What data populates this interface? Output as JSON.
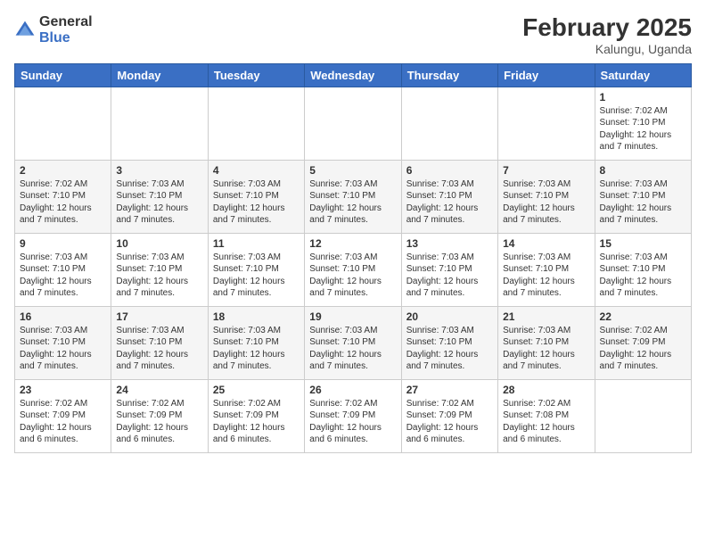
{
  "logo": {
    "general": "General",
    "blue": "Blue"
  },
  "title": "February 2025",
  "location": "Kalungu, Uganda",
  "days_header": [
    "Sunday",
    "Monday",
    "Tuesday",
    "Wednesday",
    "Thursday",
    "Friday",
    "Saturday"
  ],
  "weeks": [
    [
      {
        "day": "",
        "info": ""
      },
      {
        "day": "",
        "info": ""
      },
      {
        "day": "",
        "info": ""
      },
      {
        "day": "",
        "info": ""
      },
      {
        "day": "",
        "info": ""
      },
      {
        "day": "",
        "info": ""
      },
      {
        "day": "1",
        "info": "Sunrise: 7:02 AM\nSunset: 7:10 PM\nDaylight: 12 hours\nand 7 minutes."
      }
    ],
    [
      {
        "day": "2",
        "info": "Sunrise: 7:02 AM\nSunset: 7:10 PM\nDaylight: 12 hours\nand 7 minutes."
      },
      {
        "day": "3",
        "info": "Sunrise: 7:03 AM\nSunset: 7:10 PM\nDaylight: 12 hours\nand 7 minutes."
      },
      {
        "day": "4",
        "info": "Sunrise: 7:03 AM\nSunset: 7:10 PM\nDaylight: 12 hours\nand 7 minutes."
      },
      {
        "day": "5",
        "info": "Sunrise: 7:03 AM\nSunset: 7:10 PM\nDaylight: 12 hours\nand 7 minutes."
      },
      {
        "day": "6",
        "info": "Sunrise: 7:03 AM\nSunset: 7:10 PM\nDaylight: 12 hours\nand 7 minutes."
      },
      {
        "day": "7",
        "info": "Sunrise: 7:03 AM\nSunset: 7:10 PM\nDaylight: 12 hours\nand 7 minutes."
      },
      {
        "day": "8",
        "info": "Sunrise: 7:03 AM\nSunset: 7:10 PM\nDaylight: 12 hours\nand 7 minutes."
      }
    ],
    [
      {
        "day": "9",
        "info": "Sunrise: 7:03 AM\nSunset: 7:10 PM\nDaylight: 12 hours\nand 7 minutes."
      },
      {
        "day": "10",
        "info": "Sunrise: 7:03 AM\nSunset: 7:10 PM\nDaylight: 12 hours\nand 7 minutes."
      },
      {
        "day": "11",
        "info": "Sunrise: 7:03 AM\nSunset: 7:10 PM\nDaylight: 12 hours\nand 7 minutes."
      },
      {
        "day": "12",
        "info": "Sunrise: 7:03 AM\nSunset: 7:10 PM\nDaylight: 12 hours\nand 7 minutes."
      },
      {
        "day": "13",
        "info": "Sunrise: 7:03 AM\nSunset: 7:10 PM\nDaylight: 12 hours\nand 7 minutes."
      },
      {
        "day": "14",
        "info": "Sunrise: 7:03 AM\nSunset: 7:10 PM\nDaylight: 12 hours\nand 7 minutes."
      },
      {
        "day": "15",
        "info": "Sunrise: 7:03 AM\nSunset: 7:10 PM\nDaylight: 12 hours\nand 7 minutes."
      }
    ],
    [
      {
        "day": "16",
        "info": "Sunrise: 7:03 AM\nSunset: 7:10 PM\nDaylight: 12 hours\nand 7 minutes."
      },
      {
        "day": "17",
        "info": "Sunrise: 7:03 AM\nSunset: 7:10 PM\nDaylight: 12 hours\nand 7 minutes."
      },
      {
        "day": "18",
        "info": "Sunrise: 7:03 AM\nSunset: 7:10 PM\nDaylight: 12 hours\nand 7 minutes."
      },
      {
        "day": "19",
        "info": "Sunrise: 7:03 AM\nSunset: 7:10 PM\nDaylight: 12 hours\nand 7 minutes."
      },
      {
        "day": "20",
        "info": "Sunrise: 7:03 AM\nSunset: 7:10 PM\nDaylight: 12 hours\nand 7 minutes."
      },
      {
        "day": "21",
        "info": "Sunrise: 7:03 AM\nSunset: 7:10 PM\nDaylight: 12 hours\nand 7 minutes."
      },
      {
        "day": "22",
        "info": "Sunrise: 7:02 AM\nSunset: 7:09 PM\nDaylight: 12 hours\nand 7 minutes."
      }
    ],
    [
      {
        "day": "23",
        "info": "Sunrise: 7:02 AM\nSunset: 7:09 PM\nDaylight: 12 hours\nand 6 minutes."
      },
      {
        "day": "24",
        "info": "Sunrise: 7:02 AM\nSunset: 7:09 PM\nDaylight: 12 hours\nand 6 minutes."
      },
      {
        "day": "25",
        "info": "Sunrise: 7:02 AM\nSunset: 7:09 PM\nDaylight: 12 hours\nand 6 minutes."
      },
      {
        "day": "26",
        "info": "Sunrise: 7:02 AM\nSunset: 7:09 PM\nDaylight: 12 hours\nand 6 minutes."
      },
      {
        "day": "27",
        "info": "Sunrise: 7:02 AM\nSunset: 7:09 PM\nDaylight: 12 hours\nand 6 minutes."
      },
      {
        "day": "28",
        "info": "Sunrise: 7:02 AM\nSunset: 7:08 PM\nDaylight: 12 hours\nand 6 minutes."
      },
      {
        "day": "",
        "info": ""
      }
    ]
  ]
}
